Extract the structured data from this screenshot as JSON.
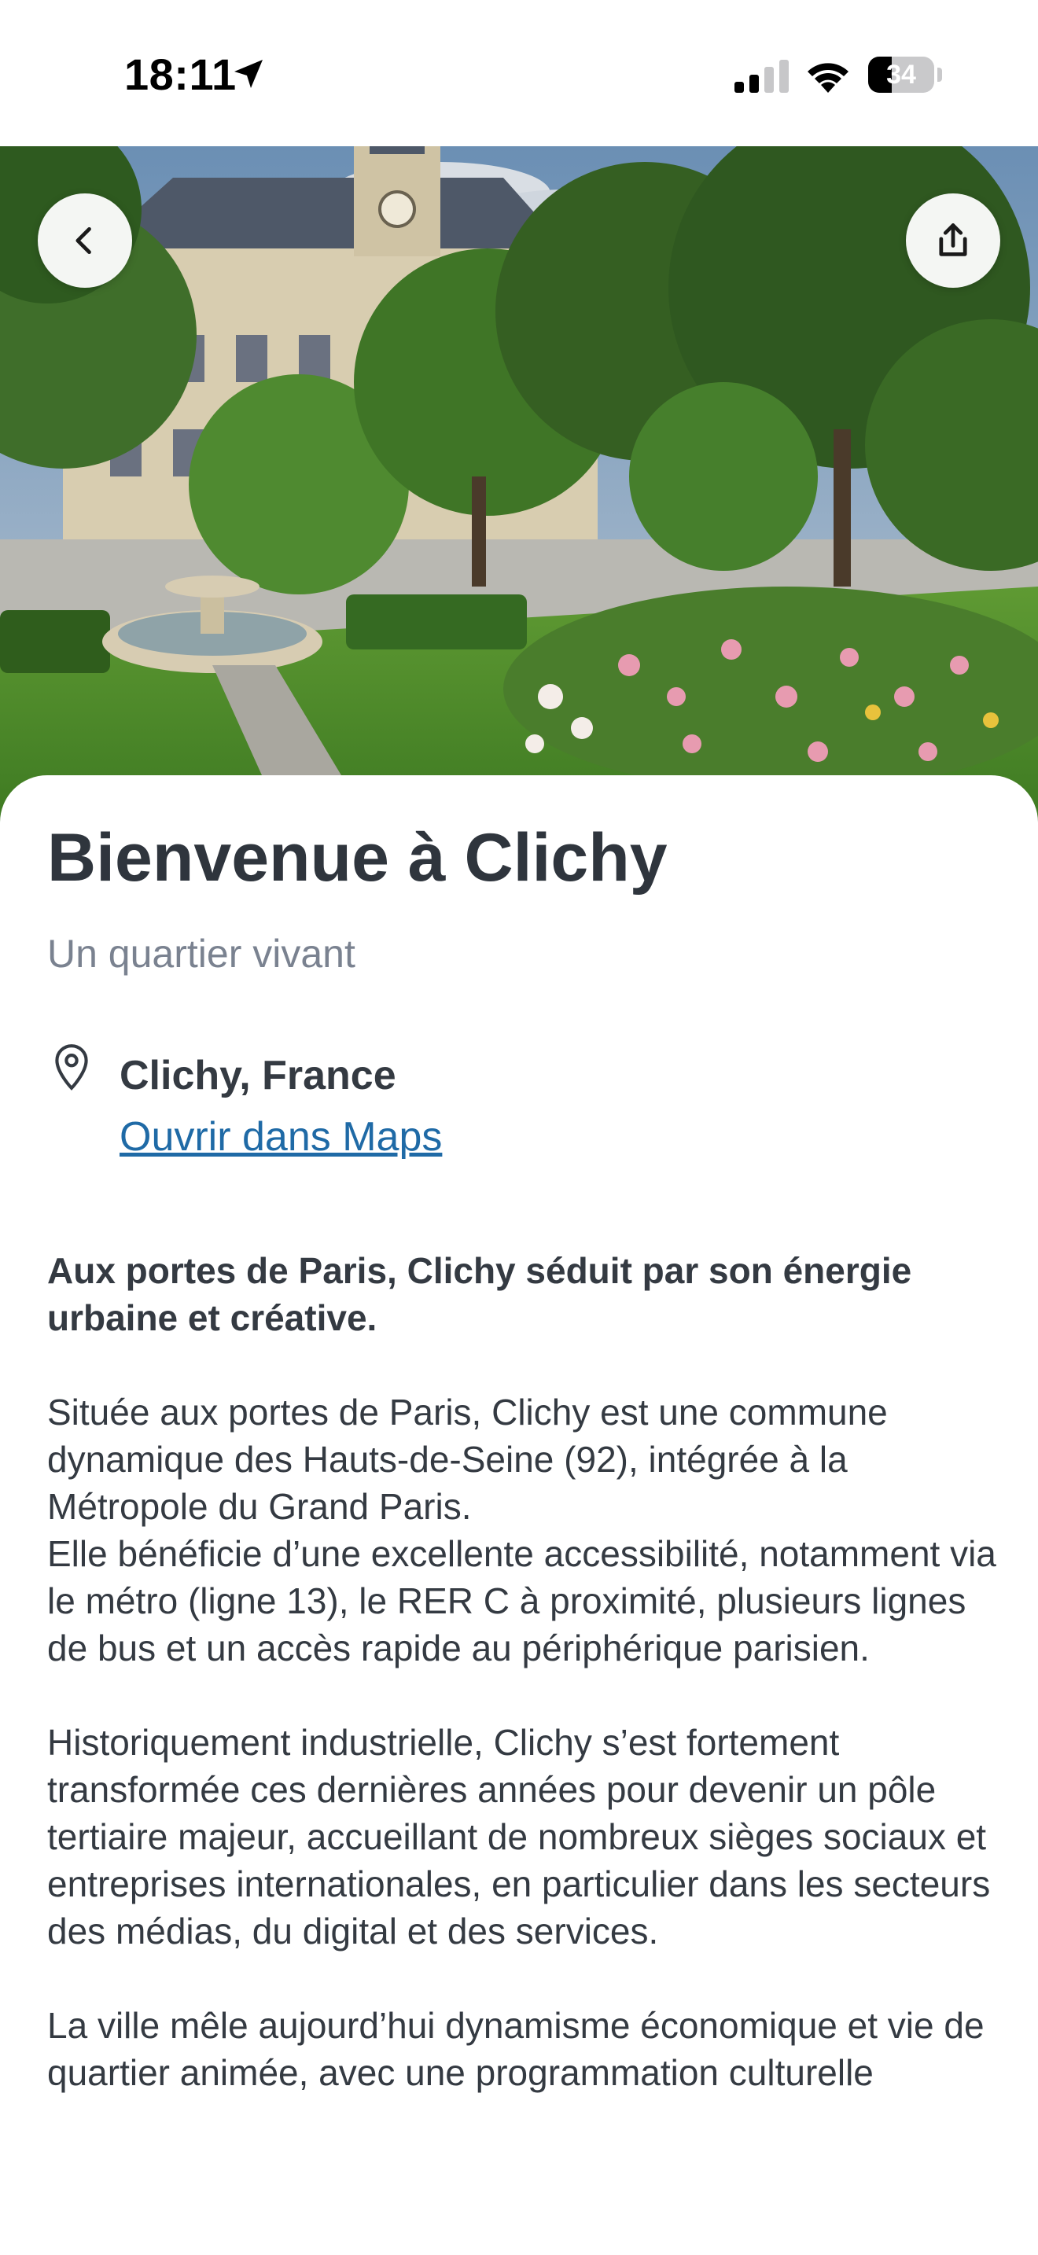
{
  "status_bar": {
    "time": "18:11",
    "battery_level": "34",
    "icons": [
      "location-arrow-icon",
      "signal-icon",
      "wifi-icon",
      "battery-icon"
    ]
  },
  "hero": {
    "image": "garden-with-fountain-and-town-hall"
  },
  "nav": {
    "back_icon": "chevron-left-icon",
    "share_icon": "share-icon"
  },
  "content": {
    "title": "Bienvenue à Clichy",
    "subtitle": "Un quartier vivant",
    "location": {
      "icon": "map-pin-icon",
      "name": "Clichy, France",
      "maps_link": "Ouvrir dans Maps"
    },
    "lead": "Aux portes de Paris, Clichy séduit par son énergie urbaine et créative.",
    "paragraphs": [
      "Située aux portes de Paris, Clichy est une commune dynamique des Hauts-de-Seine (92), intégrée à la Métropole du Grand Paris.",
      "Elle bénéficie d’une excellente accessibilité, notamment via le métro (ligne 13), le RER C à proximité, plusieurs lignes de bus et un accès rapide au périphérique parisien.",
      "Historiquement industrielle, Clichy s’est fortement transformée ces dernières années pour devenir un pôle tertiaire majeur, accueillant de nombreux sièges sociaux et entreprises internationales, en particulier dans les secteurs des médias, du digital et des services.",
      "La ville mêle aujourd’hui dynamisme économique et vie de quartier animée, avec une programmation culturelle"
    ]
  },
  "colors": {
    "title": "#2f353d",
    "subtitle": "#7a8290",
    "link": "#1f6aa6",
    "text": "#343a42"
  }
}
